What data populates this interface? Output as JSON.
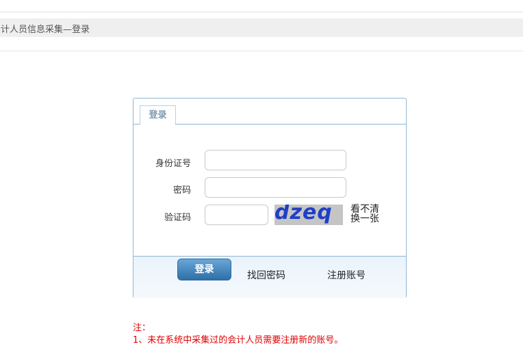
{
  "header": {
    "title": "会计人员信息采集—登录"
  },
  "login_panel": {
    "tab_label": "登录",
    "id_label": "身份证号",
    "id_value": "",
    "password_label": "密码",
    "password_value": "",
    "captcha_label": "验证码",
    "captcha_value": "",
    "captcha_text": "dzeq",
    "captcha_refresh_line1": "看不清",
    "captcha_refresh_line2": "换一张",
    "login_button": "登录",
    "forgot_password_link": "找回密码",
    "register_link": "注册账号",
    "colors": {
      "border": "#8fb6d3",
      "button": "#2d6fa7",
      "captcha_bg": "#c5c5c5",
      "captcha_text": "#1f3fc7"
    }
  },
  "notes": {
    "heading": "注：",
    "items": [
      "1、未在系统中采集过的会计人员需要注册新的账号。"
    ],
    "color": "#e00000"
  }
}
